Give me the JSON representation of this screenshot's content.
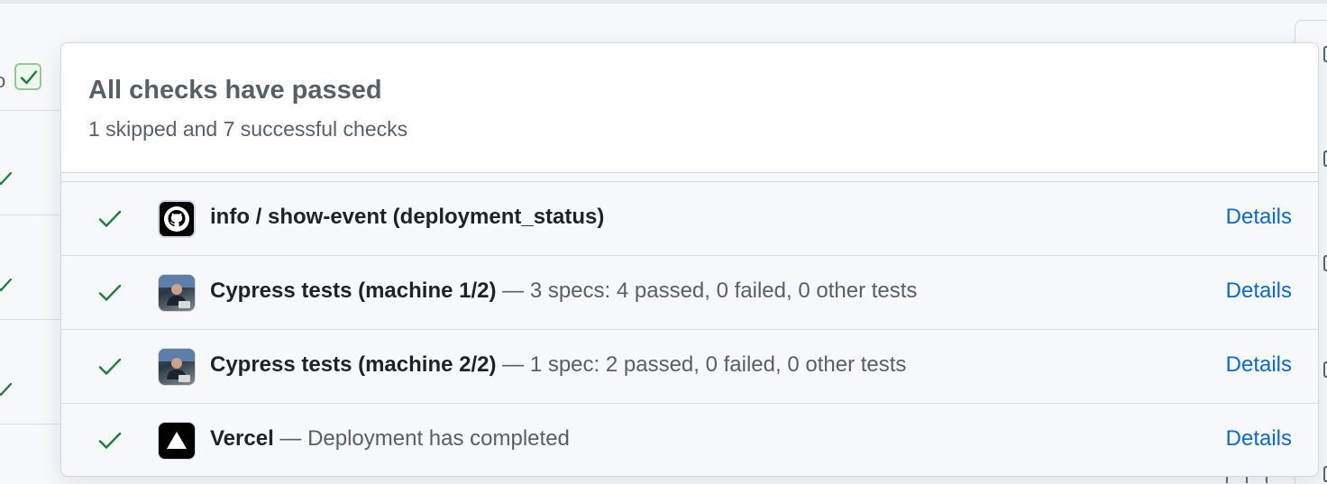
{
  "background": {
    "partial_text": "o"
  },
  "popover": {
    "title": "All checks have passed",
    "subtitle": "1 skipped and 7 successful checks"
  },
  "checks": [
    {
      "name": "info / show-event (deployment_status)",
      "description": "",
      "details_label": "Details",
      "avatar_icon": "github-icon",
      "status": "success"
    },
    {
      "name": "Cypress tests (machine 1/2)",
      "description": " — 3 specs: 4 passed, 0 failed, 0 other tests",
      "details_label": "Details",
      "avatar_icon": "user-avatar",
      "status": "success"
    },
    {
      "name": "Cypress tests (machine 2/2)",
      "description": " — 1 spec: 2 passed, 0 failed, 0 other tests",
      "details_label": "Details",
      "avatar_icon": "user-avatar",
      "status": "success"
    },
    {
      "name": "Vercel",
      "description": " — Deployment has completed",
      "details_label": "Details",
      "avatar_icon": "vercel-icon",
      "status": "success"
    }
  ],
  "colors": {
    "success": "#1a7f37",
    "link": "#0969da",
    "muted_text": "#57606a"
  }
}
